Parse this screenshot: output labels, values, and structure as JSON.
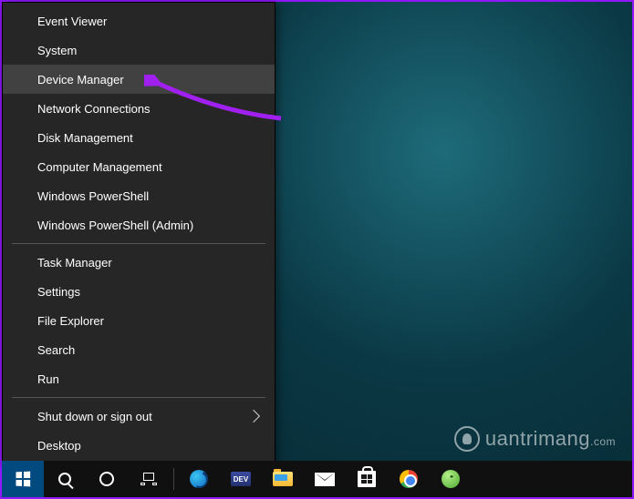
{
  "menu": {
    "groups": [
      [
        {
          "label": "Event Viewer",
          "highlight": false
        },
        {
          "label": "System",
          "highlight": false
        },
        {
          "label": "Device Manager",
          "highlight": true
        },
        {
          "label": "Network Connections",
          "highlight": false
        },
        {
          "label": "Disk Management",
          "highlight": false
        },
        {
          "label": "Computer Management",
          "highlight": false
        },
        {
          "label": "Windows PowerShell",
          "highlight": false
        },
        {
          "label": "Windows PowerShell (Admin)",
          "highlight": false
        }
      ],
      [
        {
          "label": "Task Manager",
          "highlight": false
        },
        {
          "label": "Settings",
          "highlight": false
        },
        {
          "label": "File Explorer",
          "highlight": false
        },
        {
          "label": "Search",
          "highlight": false
        },
        {
          "label": "Run",
          "highlight": false
        }
      ],
      [
        {
          "label": "Shut down or sign out",
          "highlight": false,
          "submenu": true
        },
        {
          "label": "Desktop",
          "highlight": false
        }
      ]
    ]
  },
  "taskbar": {
    "apps": [
      "edge",
      "dev",
      "explorer",
      "mail",
      "store",
      "chrome",
      "green"
    ]
  },
  "watermark": {
    "text": "uantrimang",
    "suffix": ".com"
  },
  "annotation": {
    "arrow_color": "#a020f0"
  }
}
